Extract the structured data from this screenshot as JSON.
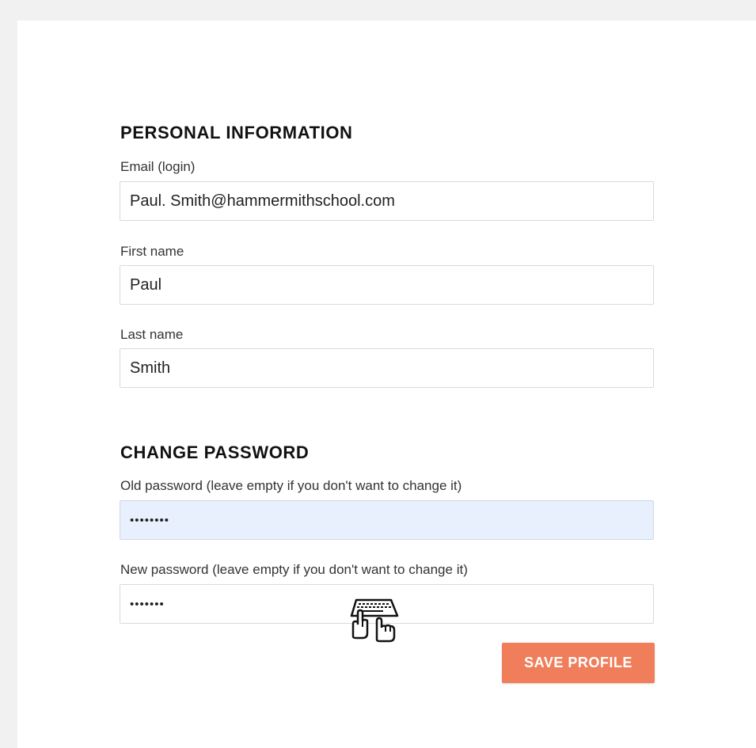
{
  "personal": {
    "title": "PERSONAL INFORMATION",
    "email_label": "Email (login)",
    "email_value": "Paul. Smith@hammermithschool.com",
    "first_name_label": "First name",
    "first_name_value": "Paul",
    "last_name_label": "Last name",
    "last_name_value": "Smith"
  },
  "password": {
    "title": "CHANGE PASSWORD",
    "old_label": "Old password (leave empty if you don't want to change it)",
    "old_value": "••••••••",
    "new_label": "New password (leave empty if you don't want to change it)",
    "new_value": "•••••••"
  },
  "actions": {
    "save_label": "SAVE PROFILE"
  },
  "colors": {
    "accent": "#f07e5a",
    "autofill_bg": "#e8f0fe",
    "page_bg": "#f1f1f1"
  },
  "icons": {
    "cursor": "typing-hands-keyboard-icon"
  }
}
